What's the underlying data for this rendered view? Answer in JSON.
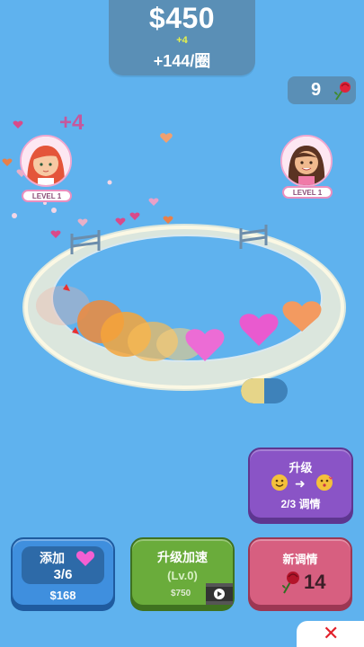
{
  "top": {
    "money": "$450",
    "money_bonus": "+4",
    "per_lap": "+144/圈"
  },
  "roses": {
    "count": "9"
  },
  "characters": [
    {
      "level": "LEVEL 1",
      "gain": "+4"
    },
    {
      "level": "LEVEL 1"
    }
  ],
  "buttons": {
    "upgrade_match": {
      "title": "升级",
      "progress": "2/3 调情"
    },
    "add": {
      "label": "添加",
      "count": "3/6",
      "price": "$168"
    },
    "speed": {
      "title": "升级加速",
      "level": "(Lv.0)",
      "price": "$750"
    },
    "new_flirt": {
      "title": "新调情",
      "count": "14"
    }
  },
  "colors": {
    "background": "#5fb2ee",
    "panel": "#5a8fb6",
    "add_button": "#3f8fde",
    "speed_button": "#6aac3b",
    "upgrade_button": "#8a54c6",
    "flirt_button": "#d75f80"
  }
}
